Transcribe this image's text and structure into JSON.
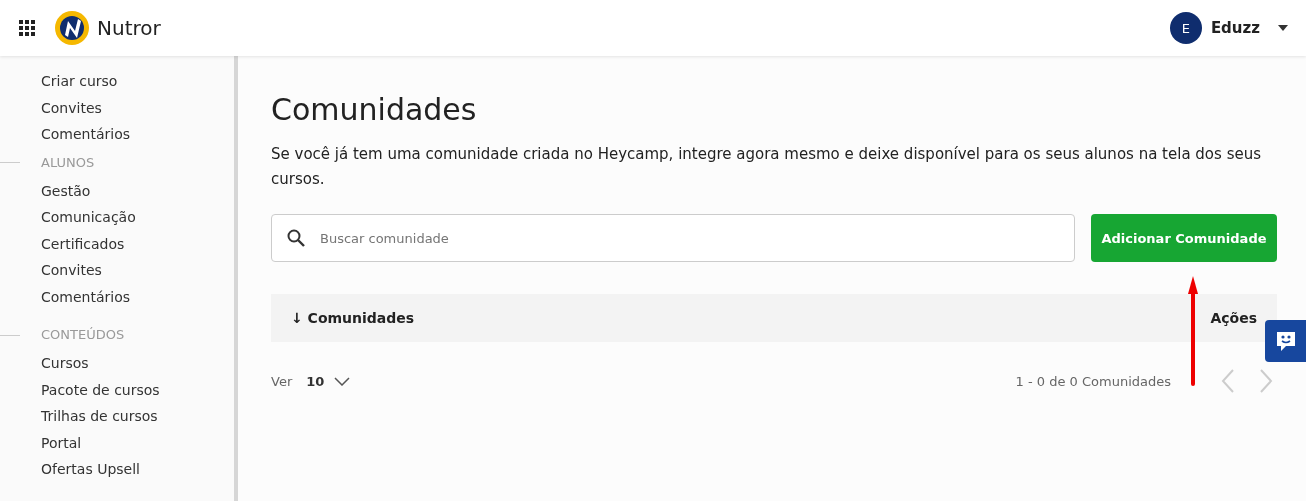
{
  "header": {
    "brand": "Nutror",
    "user": {
      "initial": "E",
      "name": "Eduzz"
    }
  },
  "sidebar": {
    "sections": [
      {
        "items": [
          "Criar curso",
          "Convites",
          "Comentários"
        ]
      },
      {
        "title": "ALUNOS",
        "items": [
          "Gestão",
          "Comunicação",
          "Certificados",
          "Convites",
          "Comentários"
        ]
      },
      {
        "title": "CONTEÚDOS",
        "items": [
          "Cursos",
          "Pacote de cursos",
          "Trilhas de cursos",
          "Portal",
          "Ofertas Upsell"
        ]
      }
    ]
  },
  "page": {
    "title": "Comunidades",
    "description": "Se você já tem uma comunidade criada no Heycamp, integre agora mesmo e deixe disponível para os seus alunos na tela dos seus cursos.",
    "search": {
      "placeholder": "Buscar comunidade"
    },
    "add_button": "Adicionar Comunidade",
    "table": {
      "columns": [
        {
          "label": "Comunidades",
          "sort": "↓"
        },
        {
          "label": "Ações"
        }
      ]
    },
    "pagination": {
      "per_page_label": "Ver",
      "per_page": "10",
      "range": "1 - 0 de 0 Comunidades"
    }
  }
}
